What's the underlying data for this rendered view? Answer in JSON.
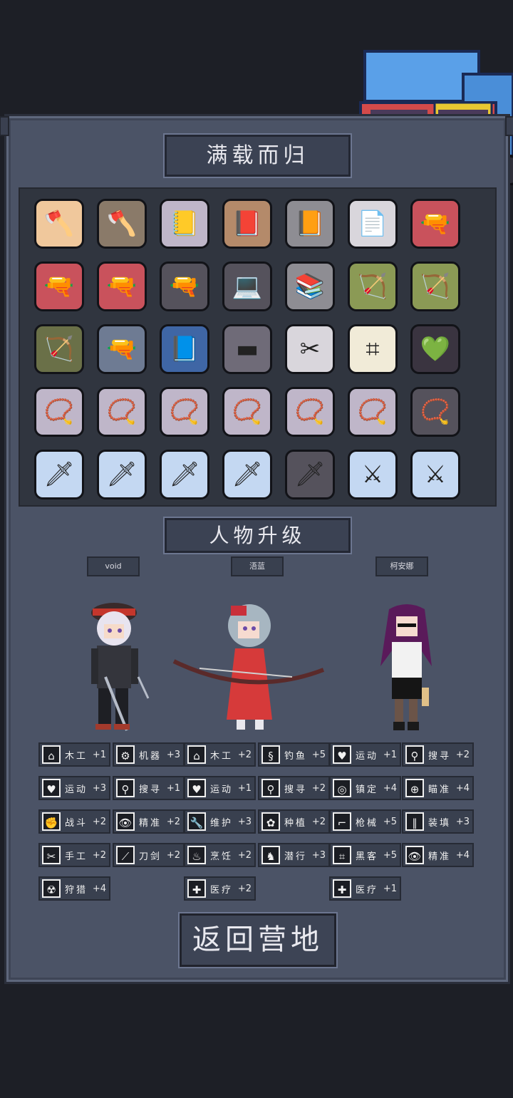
{
  "titles": {
    "loot": "满载而归",
    "upgrade": "人物升级"
  },
  "inventory": [
    [
      {
        "icon": "axe-icon",
        "glyph": "🪓",
        "bg": "bg-peach"
      },
      {
        "icon": "axe-icon",
        "glyph": "🪓",
        "bg": "bg-brown"
      },
      {
        "icon": "yellow-book-icon",
        "glyph": "📒",
        "bg": "bg-lilac"
      },
      {
        "icon": "phone-book-icon",
        "glyph": "📕",
        "bg": "bg-tan"
      },
      {
        "icon": "ruby-book-icon",
        "glyph": "📙",
        "bg": "bg-grey"
      },
      {
        "icon": "document-icon",
        "glyph": "📄",
        "bg": "bg-pale"
      },
      {
        "icon": "pistol-icon",
        "glyph": "🔫",
        "bg": "bg-red"
      }
    ],
    [
      {
        "icon": "pistol-icon",
        "glyph": "🔫",
        "bg": "bg-red"
      },
      {
        "icon": "pistol-icon",
        "glyph": "🔫",
        "bg": "bg-red"
      },
      {
        "icon": "pistol-icon",
        "glyph": "🔫",
        "bg": "bg-dark"
      },
      {
        "icon": "laptop-icon",
        "glyph": "💻",
        "bg": "bg-dark"
      },
      {
        "icon": "books-icon",
        "glyph": "📚",
        "bg": "bg-grey"
      },
      {
        "icon": "bow-icon",
        "glyph": "🏹",
        "bg": "bg-olive"
      },
      {
        "icon": "bow-icon",
        "glyph": "🏹",
        "bg": "bg-olive"
      }
    ],
    [
      {
        "icon": "bow-icon",
        "glyph": "🏹",
        "bg": "bg-green"
      },
      {
        "icon": "shotgun-icon",
        "glyph": "🔫",
        "bg": "bg-steel"
      },
      {
        "icon": "blue-book-icon",
        "glyph": "📘",
        "bg": "bg-blue"
      },
      {
        "icon": "slate-icon",
        "glyph": "▬",
        "bg": "bg-slate"
      },
      {
        "icon": "scissors-card-icon",
        "glyph": "✂",
        "bg": "bg-pale"
      },
      {
        "icon": "circuit-card-icon",
        "glyph": "⌗",
        "bg": "bg-cream"
      },
      {
        "icon": "heart-book-icon",
        "glyph": "💚",
        "bg": "bg-board"
      }
    ],
    [
      {
        "icon": "amulet-icon",
        "glyph": "📿",
        "bg": "bg-lilac"
      },
      {
        "icon": "amulet-icon",
        "glyph": "📿",
        "bg": "bg-lilac"
      },
      {
        "icon": "amulet-icon",
        "glyph": "📿",
        "bg": "bg-lilac"
      },
      {
        "icon": "amulet-icon",
        "glyph": "📿",
        "bg": "bg-lilac"
      },
      {
        "icon": "amulet-icon",
        "glyph": "📿",
        "bg": "bg-lilac"
      },
      {
        "icon": "amulet-icon",
        "glyph": "📿",
        "bg": "bg-lilac"
      },
      {
        "icon": "amulet-icon",
        "glyph": "📿",
        "bg": "bg-dark"
      }
    ],
    [
      {
        "icon": "chainsaw-icon",
        "glyph": "🗡",
        "bg": "bg-ice"
      },
      {
        "icon": "chainsaw-icon",
        "glyph": "🗡",
        "bg": "bg-ice"
      },
      {
        "icon": "chainsaw-icon",
        "glyph": "🗡",
        "bg": "bg-ice"
      },
      {
        "icon": "chainsaw-icon",
        "glyph": "🗡",
        "bg": "bg-ice"
      },
      {
        "icon": "chainsaw-icon",
        "glyph": "🗡",
        "bg": "bg-dark"
      },
      {
        "icon": "ice-sword-icon",
        "glyph": "⚔",
        "bg": "bg-ice"
      },
      {
        "icon": "ice-sword-icon",
        "glyph": "⚔",
        "bg": "bg-ice"
      }
    ]
  ],
  "characters": [
    {
      "name": "void"
    },
    {
      "name": "浯蓝"
    },
    {
      "name": "柯安娜"
    }
  ],
  "skills": [
    [
      {
        "icon": "house-icon",
        "glyph": "⌂",
        "name": "木工",
        "val": "+1"
      },
      {
        "icon": "gear-icon",
        "glyph": "⚙",
        "name": "机器",
        "val": "+3"
      },
      {
        "icon": "house-icon",
        "glyph": "⌂",
        "name": "木工",
        "val": "+2"
      },
      {
        "icon": "fish-icon",
        "glyph": "§",
        "name": "钓鱼",
        "val": "+5"
      },
      {
        "icon": "heart-icon",
        "glyph": "♥",
        "name": "运动",
        "val": "+1"
      },
      {
        "icon": "magnifier-icon",
        "glyph": "⚲",
        "name": "搜寻",
        "val": "+2"
      }
    ],
    [
      {
        "icon": "heart-icon",
        "glyph": "♥",
        "name": "运动",
        "val": "+3"
      },
      {
        "icon": "magnifier-icon",
        "glyph": "⚲",
        "name": "搜寻",
        "val": "+1"
      },
      {
        "icon": "heart-icon",
        "glyph": "♥",
        "name": "运动",
        "val": "+1"
      },
      {
        "icon": "magnifier-icon",
        "glyph": "⚲",
        "name": "搜寻",
        "val": "+2"
      },
      {
        "icon": "glasses-icon",
        "glyph": "◎",
        "name": "镇定",
        "val": "+4"
      },
      {
        "icon": "crosshair-icon",
        "glyph": "⊕",
        "name": "瞄准",
        "val": "+4"
      }
    ],
    [
      {
        "icon": "fist-icon",
        "glyph": "✊",
        "name": "战斗",
        "val": "+2"
      },
      {
        "icon": "eye-icon",
        "glyph": "👁",
        "name": "精准",
        "val": "+2"
      },
      {
        "icon": "wrench-icon",
        "glyph": "🔧",
        "name": "维护",
        "val": "+3"
      },
      {
        "icon": "plant-icon",
        "glyph": "✿",
        "name": "种植",
        "val": "+2"
      },
      {
        "icon": "gun-icon",
        "glyph": "⌐",
        "name": "枪械",
        "val": "+5"
      },
      {
        "icon": "bullets-icon",
        "glyph": "∥",
        "name": "装填",
        "val": "+3"
      }
    ],
    [
      {
        "icon": "scissors-icon",
        "glyph": "✂",
        "name": "手工",
        "val": "+2"
      },
      {
        "icon": "sword-icon",
        "glyph": "⟋",
        "name": "刀剑",
        "val": "+2"
      },
      {
        "icon": "cooking-icon",
        "glyph": "♨",
        "name": "烹饪",
        "val": "+2"
      },
      {
        "icon": "sneak-icon",
        "glyph": "♞",
        "name": "潜行",
        "val": "+3"
      },
      {
        "icon": "circuit-icon",
        "glyph": "⌗",
        "name": "黑客",
        "val": "+5"
      },
      {
        "icon": "eye-icon",
        "glyph": "👁",
        "name": "精准",
        "val": "+4"
      }
    ],
    [
      {
        "icon": "hazard-icon",
        "glyph": "☢",
        "name": "狩猎",
        "val": "+4",
        "col": 0
      },
      {
        "icon": "medkit-icon",
        "glyph": "✚",
        "name": "医疗",
        "val": "+2",
        "col": 2
      },
      {
        "icon": "medkit-icon",
        "glyph": "✚",
        "name": "医疗",
        "val": "+1",
        "col": 4
      }
    ]
  ],
  "return_button": "返回营地"
}
